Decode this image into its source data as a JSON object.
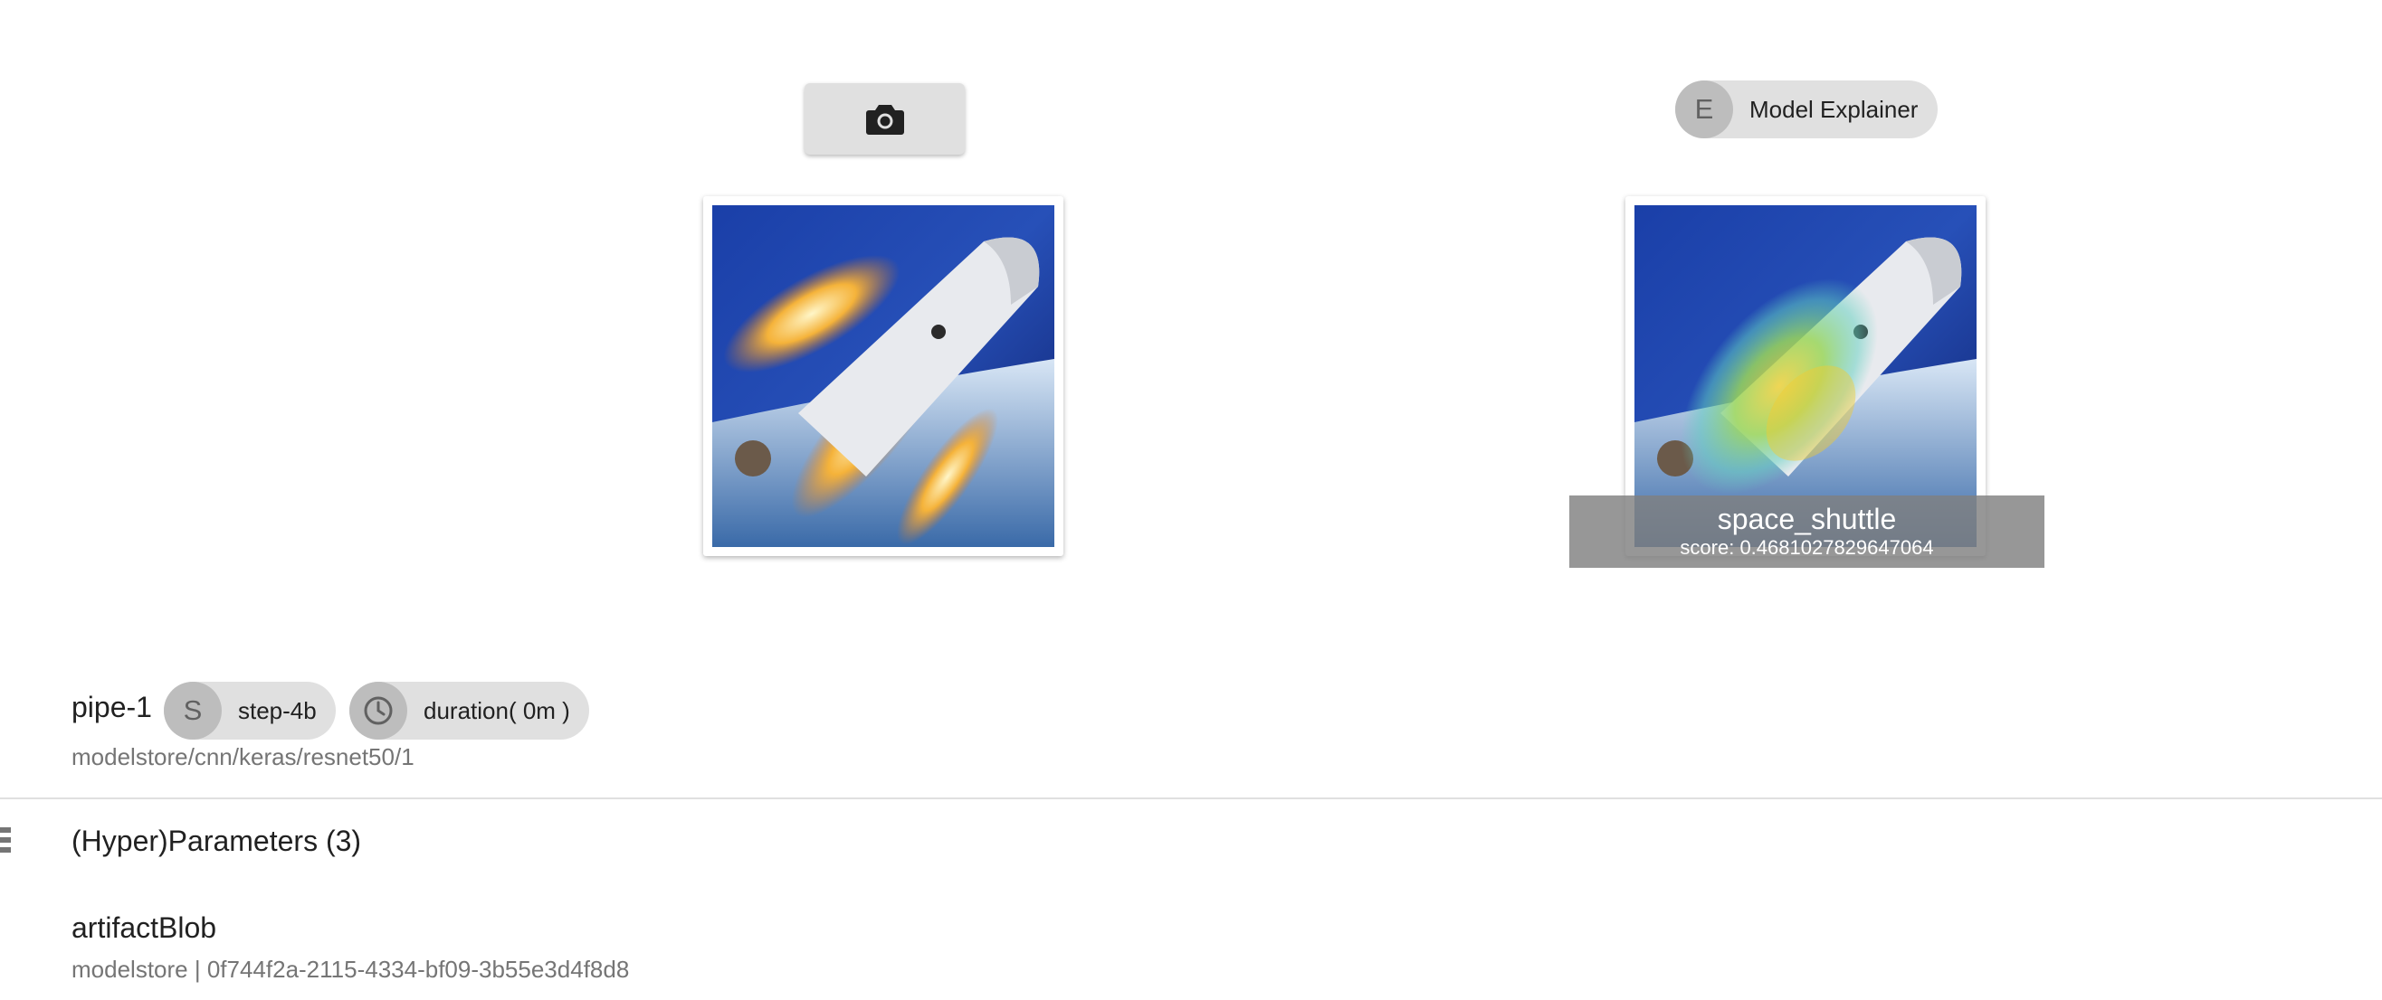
{
  "camera_button": {
    "icon": "camera-icon"
  },
  "explainer": {
    "avatar_letter": "E",
    "label": "Model Explainer"
  },
  "result": {
    "class_name": "space_shuttle",
    "score_text": "score: 0.4681027829647064"
  },
  "pipeline": {
    "name": "pipe-1",
    "step": {
      "avatar_letter": "S",
      "label": "step-4b"
    },
    "duration": {
      "icon": "clock-icon",
      "label": "duration( 0m )"
    },
    "model_path": "modelstore/cnn/keras/resnet50/1"
  },
  "parameters": {
    "title": "(Hyper)Parameters (3)"
  },
  "artifact": {
    "title": "artifactBlob",
    "subtitle": "modelstore | 0f744f2a-2115-4334-bf09-3b55e3d4f8d8"
  },
  "colors": {
    "chip_bg": "#e0e0e0",
    "avatar_bg": "#bdbdbd",
    "caption_bg": "#808080",
    "muted_text": "#757575"
  }
}
